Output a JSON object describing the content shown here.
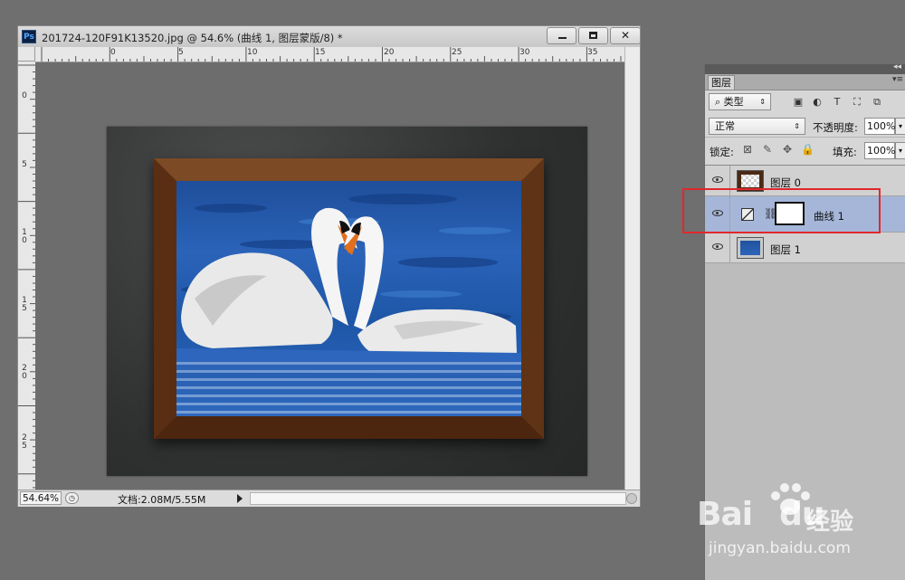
{
  "document": {
    "title": "201724-120F91K13520.jpg @ 54.6% (曲线 1, 图层蒙版/8) *",
    "app_icon": "Ps",
    "ruler_top": [
      "0",
      "5",
      "10",
      "15",
      "20",
      "25",
      "30",
      "35"
    ],
    "ruler_left": [
      "0",
      "5",
      "10",
      "15",
      "20",
      "25"
    ],
    "zoom": "54.64%",
    "doc_size": "文档:2.08M/5.55M"
  },
  "layers_panel": {
    "tab": "图层",
    "filter_kind": "类型",
    "filter_icons": [
      "image-filter-icon",
      "adjustment-filter-icon",
      "type-filter-icon",
      "shape-filter-icon",
      "smart-object-filter-icon"
    ],
    "blend_mode": "正常",
    "opacity_label": "不透明度:",
    "opacity_value": "100%",
    "lock_label": "锁定:",
    "fill_label": "填充:",
    "fill_value": "100%",
    "layers": [
      {
        "name": "图层 0",
        "visible": true,
        "selected": false
      },
      {
        "name": "曲线 1",
        "visible": true,
        "selected": true
      },
      {
        "name": "图层 1",
        "visible": true,
        "selected": false
      }
    ]
  },
  "watermark": {
    "brand": "Bai",
    "brand_suffix": "du",
    "cn": "经验",
    "url": "jingyan.baidu.com"
  },
  "colors": {
    "highlight": "#e0282d",
    "selected_layer": "#a5b6d9"
  }
}
